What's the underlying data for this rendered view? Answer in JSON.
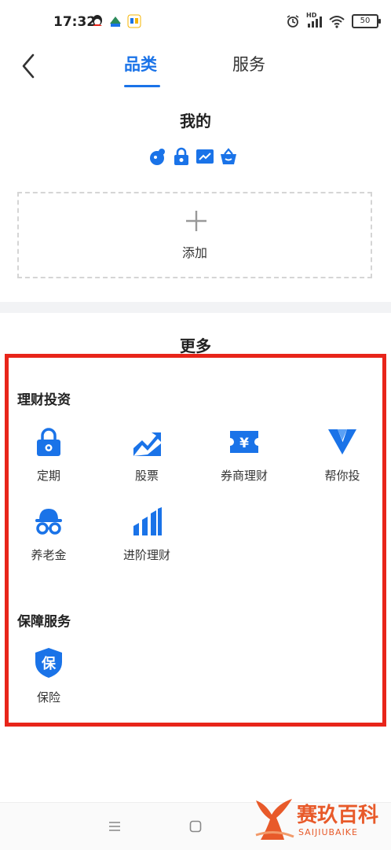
{
  "status": {
    "time": "17:32",
    "battery": "50",
    "hd_label": "HD"
  },
  "nav": {
    "tabs": [
      "品类",
      "服务"
    ],
    "active_tab": "品类"
  },
  "my_section": {
    "title": "我的",
    "add_label": "添加"
  },
  "more_section": {
    "title": "更多",
    "groups": [
      {
        "title": "理财投资",
        "items": [
          "定期",
          "股票",
          "券商理财",
          "帮你投",
          "养老金",
          "进阶理财"
        ]
      },
      {
        "title": "保障服务",
        "items": [
          "保险"
        ]
      }
    ]
  },
  "icon_glyphs": {
    "broker": "¥",
    "insurance": "保"
  },
  "colors": {
    "accent": "#1a73e8",
    "highlight_box": "#e8251a",
    "watermark": "#e85a2a"
  },
  "watermark": {
    "text": "赛玖百科",
    "sub": "SAIJIUBAIKE"
  }
}
